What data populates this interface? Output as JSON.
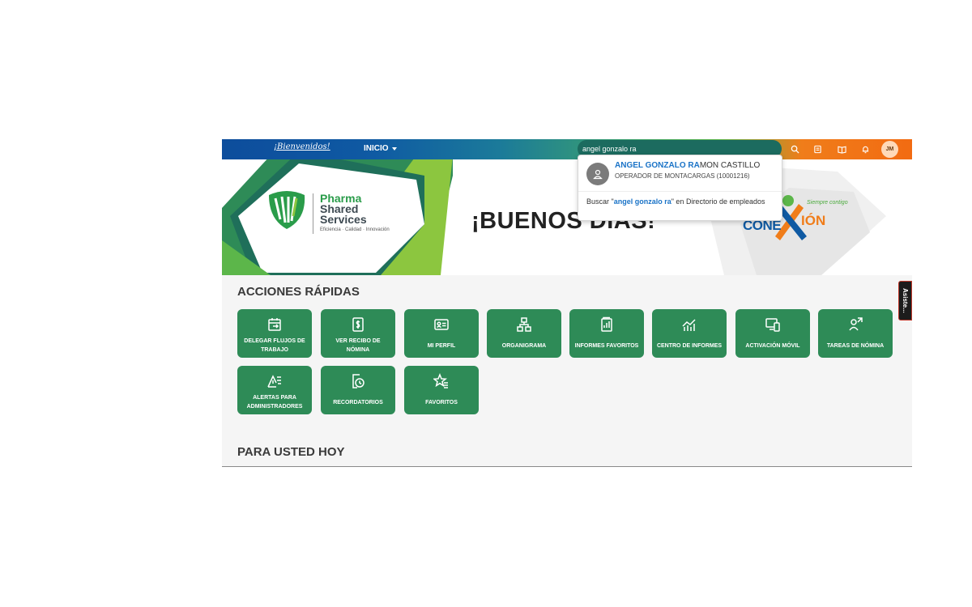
{
  "header": {
    "welcome": "¡Bienvenidos!",
    "nav_label": "INICIO",
    "search_value": "angel gonzalo ra",
    "icons": [
      "search-icon",
      "notes-icon",
      "book-icon",
      "bell-icon"
    ],
    "user_initials": "JM"
  },
  "banner": {
    "logo_line1": "Pharma",
    "logo_line2": "Shared",
    "logo_line3": "Services",
    "logo_tagline": "Eficiencia · Calidad · Innovación",
    "greeting": "¡BUENOS DÍAS!",
    "brand_left": "CONE",
    "brand_right": "IÓN",
    "brand_tagline": "Siempre contigo"
  },
  "sections": {
    "quick_actions": "ACCIONES RÁPIDAS",
    "today": "PARA USTED HOY"
  },
  "tiles": [
    {
      "label": "DELEGAR FLUJOS DE TRABAJO",
      "icon": "calendar-arrow-icon"
    },
    {
      "label": "VER RECIBO DE NÓMINA",
      "icon": "receipt-dollar-icon"
    },
    {
      "label": "MI PERFIL",
      "icon": "id-card-icon"
    },
    {
      "label": "ORGANIGRAMA",
      "icon": "org-chart-icon"
    },
    {
      "label": "INFORMES FAVORITOS",
      "icon": "report-icon"
    },
    {
      "label": "CENTRO DE INFORMES",
      "icon": "chart-line-icon"
    },
    {
      "label": "ACTIVACIÓN MÓVIL",
      "icon": "devices-icon"
    },
    {
      "label": "TAREAS DE NÓMINA",
      "icon": "person-task-icon"
    },
    {
      "label": "ALERTAS PARA ADMINISTRADORES",
      "icon": "alert-list-icon"
    },
    {
      "label": "RECORDATORIOS",
      "icon": "reminder-icon"
    },
    {
      "label": "FAVORITOS",
      "icon": "star-list-icon"
    }
  ],
  "assistant_tab": "Asiste...",
  "dropdown": {
    "result_name_match": "ANGEL GONZALO RA",
    "result_name_rest": "MON CASTILLO",
    "result_role": "OPERADOR DE MONTACARGAS (10001216)",
    "search_prefix": "Buscar \"",
    "search_term": "angel gonzalo ra",
    "search_suffix": "\" en Directorio de empleados"
  },
  "colors": {
    "tile_green": "#2e8b57",
    "highlight_blue": "#1a73c7",
    "brand_orange": "#f07d1a"
  }
}
